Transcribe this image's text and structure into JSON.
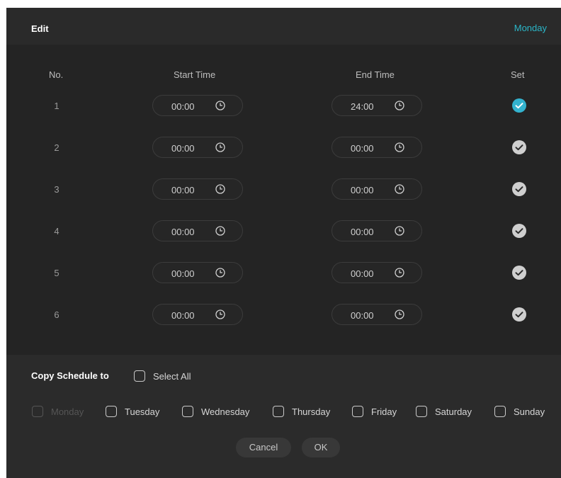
{
  "header": {
    "title": "Edit",
    "day": "Monday"
  },
  "columns": {
    "no": "No.",
    "start": "Start Time",
    "end": "End Time",
    "set": "Set"
  },
  "rows": [
    {
      "no": "1",
      "start": "00:00",
      "end": "24:00",
      "set": true
    },
    {
      "no": "2",
      "start": "00:00",
      "end": "00:00",
      "set": false
    },
    {
      "no": "3",
      "start": "00:00",
      "end": "00:00",
      "set": false
    },
    {
      "no": "4",
      "start": "00:00",
      "end": "00:00",
      "set": false
    },
    {
      "no": "5",
      "start": "00:00",
      "end": "00:00",
      "set": false
    },
    {
      "no": "6",
      "start": "00:00",
      "end": "00:00",
      "set": false
    }
  ],
  "copy": {
    "label": "Copy Schedule to",
    "select_all": "Select All",
    "days": [
      {
        "label": "Monday",
        "disabled": true
      },
      {
        "label": "Tuesday",
        "disabled": false
      },
      {
        "label": "Wednesday",
        "disabled": false
      },
      {
        "label": "Thursday",
        "disabled": false
      },
      {
        "label": "Friday",
        "disabled": false
      },
      {
        "label": "Saturday",
        "disabled": false
      },
      {
        "label": "Sunday",
        "disabled": false
      }
    ]
  },
  "buttons": {
    "cancel": "Cancel",
    "ok": "OK"
  },
  "colors": {
    "accent": "#2ab6c8",
    "check_on": "#33b3cf",
    "background": "#242424"
  },
  "icons": {
    "time": "clock-icon",
    "set_on": "checkmark-circle-icon",
    "set_off": "checkmark-circle-icon"
  }
}
